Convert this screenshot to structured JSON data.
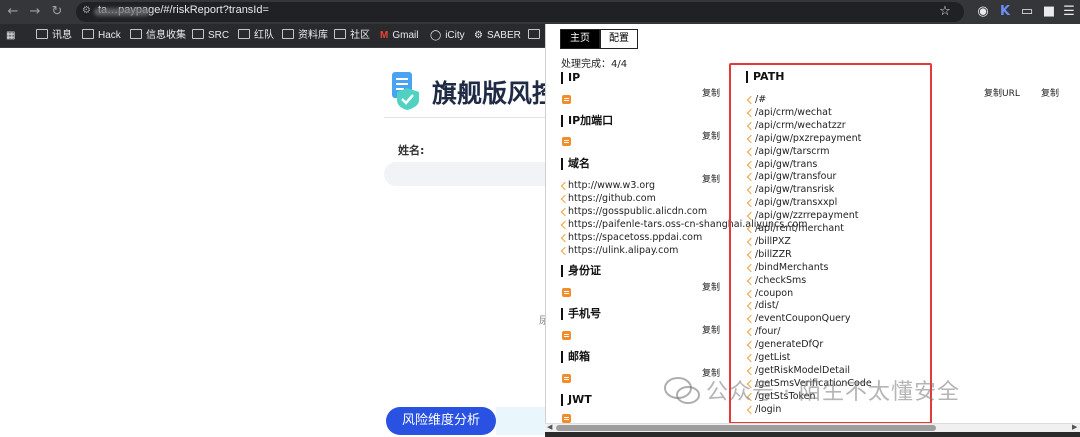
{
  "browser": {
    "url": "ta…paypage/#/riskReport?transId=",
    "bookmarks": [
      {
        "label": "讯息"
      },
      {
        "label": "Hack"
      },
      {
        "label": "信息收集"
      },
      {
        "label": "SRC"
      },
      {
        "label": "红队"
      },
      {
        "label": "资料库"
      },
      {
        "label": "社区"
      },
      {
        "label": "Gmail"
      },
      {
        "label": "iCity"
      },
      {
        "label": "SABER"
      }
    ]
  },
  "page": {
    "title": "旗舰版风控",
    "name_label": "姓名:",
    "faint_char": "尿",
    "analyze_button": "风险维度分析"
  },
  "panel": {
    "tabs": {
      "home": "主页",
      "config": "配置"
    },
    "status": "处理完成：4/4",
    "copy_label": "复制",
    "copy_url_label": "复制URL",
    "sections": {
      "ip": "IP",
      "ip_port": "IP加端口",
      "domain": "域名",
      "id_card": "身份证",
      "phone": "手机号",
      "email": "邮箱",
      "jwt": "JWT",
      "path": "PATH"
    },
    "domains": [
      "http://www.w3.org",
      "https://github.com",
      "https://gosspublic.alicdn.com",
      "https://paifenle-tars.oss-cn-shanghai.aliyuncs.com",
      "https://spacetoss.ppdai.com",
      "https://ulink.alipay.com"
    ],
    "paths": [
      "/#",
      "/api/crm/wechat",
      "/api/crm/wechatzzr",
      "/api/gw/pxzrepayment",
      "/api/gw/tarscrm",
      "/api/gw/trans",
      "/api/gw/transfour",
      "/api/gw/transrisk",
      "/api/gw/transxxpl",
      "/api/gw/zzrrepayment",
      "/api/rent/merchant",
      "/billPXZ",
      "/billZZR",
      "/bindMerchants",
      "/checkSms",
      "/coupon",
      "/dist/",
      "/eventCouponQuery",
      "/four/",
      "/generateDfQr",
      "/getList",
      "/getRiskModelDetail",
      "/getSmsVerificationCode",
      "/getStsToken",
      "/login"
    ]
  },
  "watermark": "公众号 · 陌生不太懂安全"
}
